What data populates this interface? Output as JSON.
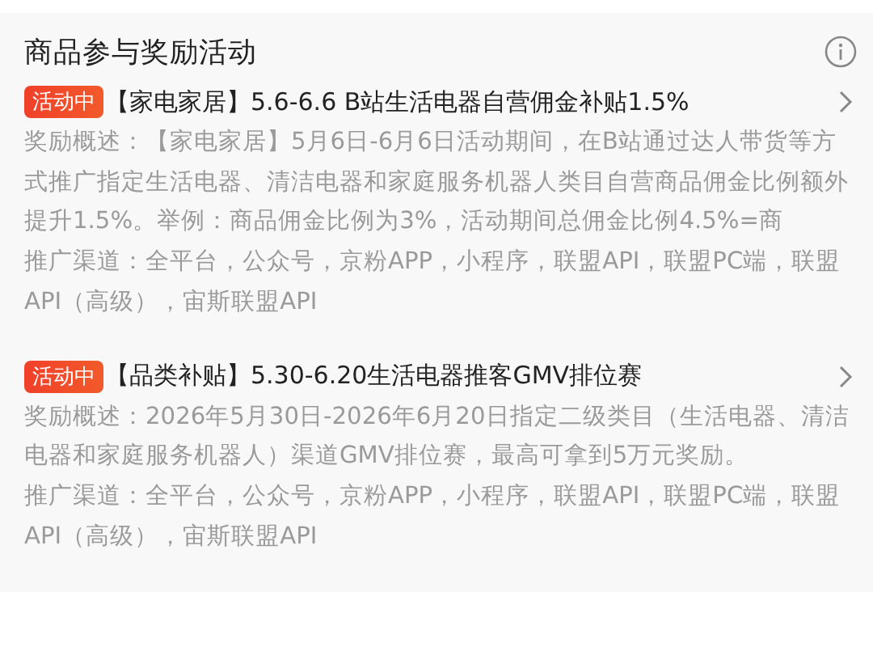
{
  "section": {
    "title": "商品参与奖励活动"
  },
  "activities": [
    {
      "badge": "活动中",
      "title": "【家电家居】5.6-6.6 B站生活电器自营佣金补贴1.5%",
      "summary": "奖励概述：【家电家居】5月6日-6月6日活动期间，在B站通过达人带货等方式推广指定生活电器、清洁电器和家庭服务机器人类目自营商品佣金比例额外提升1.5%。举例：商品佣金比例为3%，活动期间总佣金比例4.5%=商",
      "channels": "推广渠道：全平台，公众号，京粉APP，小程序，联盟API，联盟PC端，联盟API（高级），宙斯联盟API"
    },
    {
      "badge": "活动中",
      "title": "【品类补贴】5.30-6.20生活电器推客GMV排位赛",
      "summary": "奖励概述：2026年5月30日-2026年6月20日指定二级类目（生活电器、清洁电器和家庭服务机器人）渠道GMV排位赛，最高可拿到5万元奖励。",
      "channels": "推广渠道：全平台，公众号，京粉APP，小程序，联盟API，联盟PC端，联盟API（高级），宙斯联盟API"
    }
  ]
}
